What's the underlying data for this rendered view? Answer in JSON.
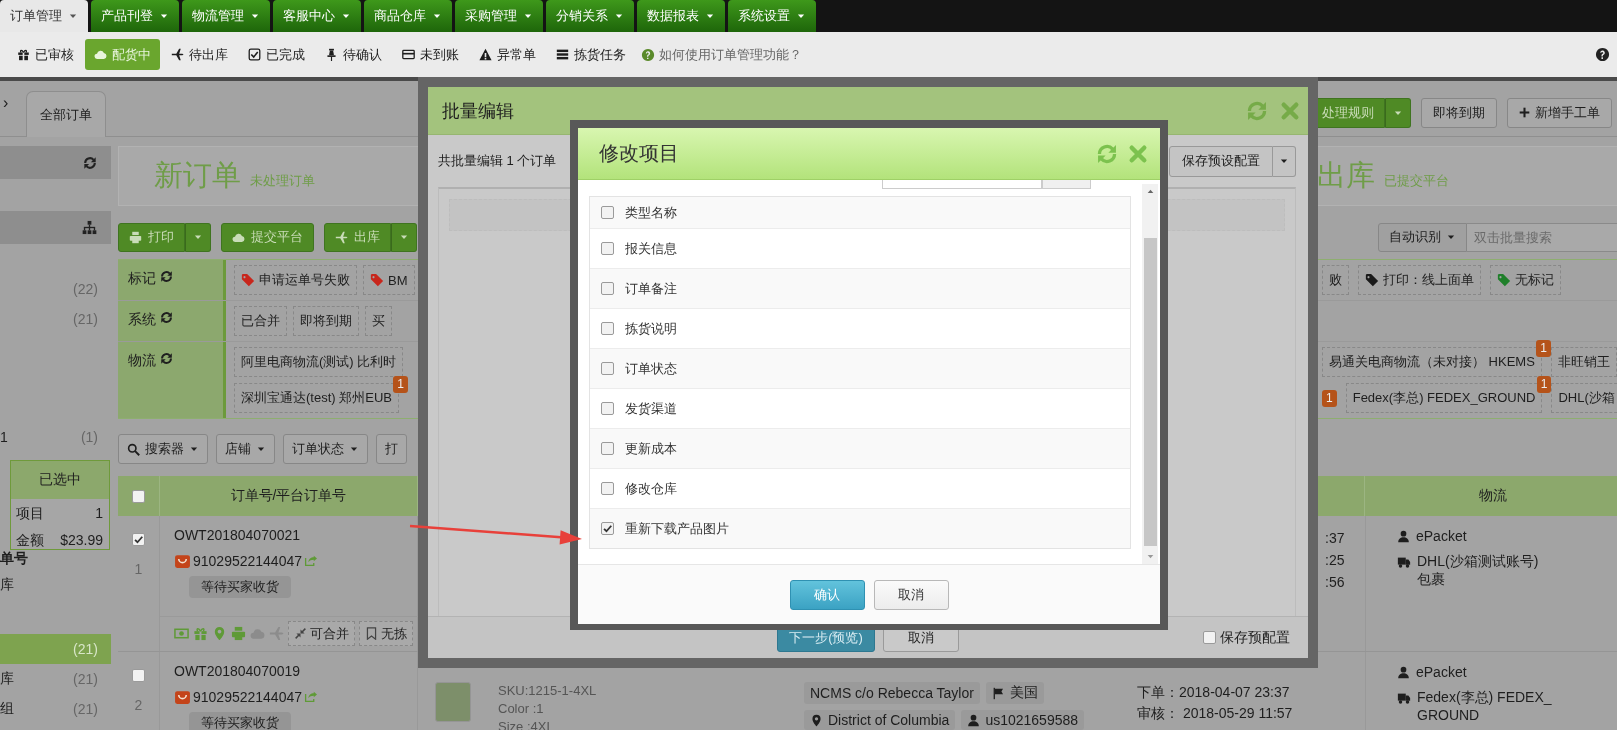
{
  "top_nav": {
    "tabs": [
      {
        "label": "订单管理",
        "selected": true
      },
      {
        "label": "产品刊登",
        "selected": false
      },
      {
        "label": "物流管理",
        "selected": false
      },
      {
        "label": "客服中心",
        "selected": false
      },
      {
        "label": "商品仓库",
        "selected": false
      },
      {
        "label": "采购管理",
        "selected": false
      },
      {
        "label": "分销关系",
        "selected": false
      },
      {
        "label": "数据报表",
        "selected": false
      },
      {
        "label": "系统设置",
        "selected": false
      }
    ]
  },
  "sub_nav": {
    "items": [
      {
        "label": "已审核",
        "selected": false
      },
      {
        "label": "配货中",
        "selected": true
      },
      {
        "label": "待出库",
        "selected": false
      },
      {
        "label": "已完成",
        "selected": false
      },
      {
        "label": "待确认",
        "selected": false
      },
      {
        "label": "未到账",
        "selected": false
      },
      {
        "label": "异常单",
        "selected": false
      },
      {
        "label": "拣货任务",
        "selected": false
      }
    ],
    "help": "如何使用订单管理功能？"
  },
  "workspace": {
    "expander": "›",
    "tabs": [
      {
        "label": "全部订单",
        "selected": true
      }
    ],
    "actions": [
      {
        "label": "处理规则",
        "kind": "primary-split"
      },
      {
        "label": "即将到期",
        "kind": "plain"
      },
      {
        "label": "新增手工单",
        "kind": "add"
      }
    ]
  },
  "sidebar": {
    "items": [
      {
        "kind": "header"
      },
      {
        "kind": "header"
      },
      {
        "kind": "count",
        "count": "(22)",
        "selected": false
      },
      {
        "kind": "count",
        "count": "(21)",
        "selected": false
      },
      {
        "kind": "count",
        "label": "1",
        "count": "(1)",
        "selected": false
      },
      {
        "kind": "summary",
        "title": "已选中",
        "rows": [
          {
            "label": "项目",
            "value": "1"
          },
          {
            "label": "金额",
            "value": "$23.99"
          }
        ]
      },
      {
        "kind": "text",
        "label": "单号"
      },
      {
        "kind": "text",
        "label": "库"
      },
      {
        "kind": "count",
        "count": "(21)",
        "selected": true
      },
      {
        "kind": "count",
        "label": "库",
        "count": "(21)",
        "selected": false
      },
      {
        "kind": "count",
        "label": "组",
        "count": "(21)",
        "selected": false
      }
    ]
  },
  "overview": {
    "left": {
      "title": "新订单",
      "subtitle": "未处理订单"
    },
    "right": {
      "title": "出库",
      "subtitle": "已提交平台"
    }
  },
  "toolbar": {
    "buttons": [
      {
        "label": "打印",
        "kind": "split"
      },
      {
        "label": "提交平台",
        "kind": "plain"
      },
      {
        "label": "出库",
        "kind": "split"
      }
    ],
    "mode_button": "自动识别",
    "search": {
      "placeholder": "双击批量搜索"
    }
  },
  "filters": [
    {
      "label": "标记",
      "lines": [
        {
          "left": [
            {
              "text": "申请运单号失败",
              "color": "#c8261c"
            },
            {
              "text": "BM",
              "color": "#c8261c"
            }
          ],
          "right": [
            {
              "text": "败"
            },
            {
              "text": "打印：线上面单",
              "color": "#1a1a1a"
            },
            {
              "text": "无标记",
              "color": "#1f7f2a"
            }
          ]
        }
      ]
    },
    {
      "label": "系统",
      "lines": [
        {
          "left": [
            {
              "text": "已合并"
            },
            {
              "text": "即将到期"
            },
            {
              "text": "买"
            }
          ]
        }
      ]
    },
    {
      "label": "物流",
      "lines": [
        {
          "left": [
            {
              "text": "阿里电商物流(测试) 比利时"
            }
          ],
          "right": [
            {
              "text": "易通关电商物流（未对接） HKEMS",
              "badge": "1"
            },
            {
              "text": "非旺销王"
            }
          ]
        },
        {
          "left": [
            {
              "text": "深圳宝通达(test) 郑州EUB",
              "badge": "1"
            }
          ],
          "right": [
            {
              "badge": "1"
            },
            {
              "text": "Fedex(李总) FEDEX_GROUND",
              "badge": "1"
            },
            {
              "text": "DHL(沙箱"
            }
          ]
        }
      ]
    }
  ],
  "search_buttons": [
    {
      "label": "搜索器",
      "kind": "search"
    },
    {
      "label": "店铺",
      "kind": "dropdown"
    },
    {
      "label": "订单状态",
      "kind": "dropdown"
    },
    {
      "label": "打",
      "kind": "plain"
    }
  ],
  "orders": {
    "select_all": {
      "checked": false
    },
    "order_column": "订单号/平台订单号",
    "logistics_column": "物流",
    "rows": [
      {
        "checked": true,
        "index": "1",
        "order_no": "OWT201804070021",
        "platform_no": "91029522144047",
        "status": "等待买家收货",
        "times": [
          ":37",
          ":25",
          ":56"
        ],
        "shipping": {
          "method": "ePacket",
          "carrier_lines": [
            "DHL(沙箱测试账号)",
            "包裹"
          ]
        },
        "actions": {
          "icons": [
            {
              "disabled": false
            },
            {
              "disabled": false
            },
            {
              "disabled": false
            },
            {
              "disabled": false
            },
            {
              "disabled": true
            },
            {
              "disabled": true
            }
          ],
          "tags": [
            "可合并",
            "无拣"
          ]
        }
      },
      {
        "checked": false,
        "index": "2",
        "order_no": "OWT201804070019",
        "platform_no": "91029522144047",
        "status": "等待买家收货",
        "product_lines": [
          "SKU:1215-1-4XL",
          "Color :1",
          "Size :4XL"
        ],
        "address": [
          [
            {
              "text": "NCMS c/o Rebecca Taylor",
              "kind": "name"
            },
            {
              "text": "美国",
              "kind": "country"
            }
          ],
          [
            {
              "text": "District of Columbia",
              "kind": "region"
            },
            {
              "text": "us1021659588",
              "kind": "buyer"
            }
          ]
        ],
        "times": [
          "下单：2018-04-07 23:37",
          "审核： 2018-05-29 11:57"
        ],
        "shipping": {
          "method": "ePacket",
          "carrier_lines": [
            "Fedex(李总) FEDEX_",
            "GROUND"
          ]
        }
      }
    ]
  },
  "batch_dialog": {
    "title": "批量编辑",
    "summary": "共批量编辑 1 个订单",
    "preset_button": "保存预设配置",
    "next_button": "下一步(预览)",
    "cancel_button": "取消",
    "save_preset": {
      "label": "保存预配置",
      "checked": false
    }
  },
  "items_dialog": {
    "title": "修改项目",
    "header": {
      "label": "类型名称",
      "checked": false
    },
    "items": [
      {
        "label": "报关信息",
        "checked": false
      },
      {
        "label": "订单备注",
        "checked": false
      },
      {
        "label": "拣货说明",
        "checked": false
      },
      {
        "label": "订单状态",
        "checked": false
      },
      {
        "label": "发货渠道",
        "checked": false
      },
      {
        "label": "更新成本",
        "checked": false
      },
      {
        "label": "修改仓库",
        "checked": false
      },
      {
        "label": "重新下载产品图片",
        "checked": true
      }
    ],
    "confirm_button": "确认",
    "cancel_button": "取消"
  }
}
